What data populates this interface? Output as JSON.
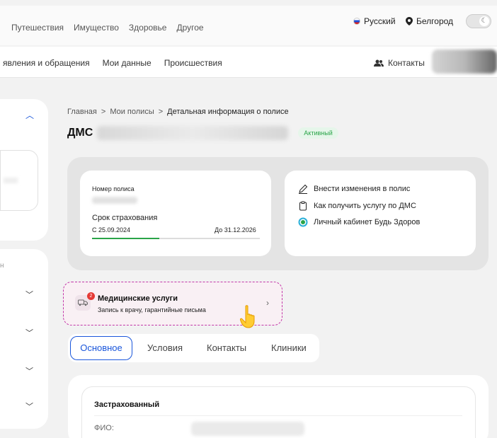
{
  "top_nav": {
    "links": [
      "Путешествия",
      "Имущество",
      "Здоровье",
      "Другое"
    ],
    "language": "Русский",
    "city": "Белгород"
  },
  "sub_nav": {
    "links": [
      "явления и обращения",
      "Мои данные",
      "Происшествия"
    ],
    "contacts": "Контакты"
  },
  "sidebar": {
    "section_label": "н"
  },
  "breadcrumb": {
    "home": "Главная",
    "policies": "Мои полисы",
    "current": "Детальная информация о полисе",
    "separator": ">"
  },
  "policy": {
    "title": "ДМС",
    "status": "Активный",
    "number_label": "Номер полиса",
    "term_label": "Срок страхования",
    "start": "С 25.09.2024",
    "end": "До 31.12.2026",
    "term_progress_fraction": 0.4
  },
  "actions": [
    {
      "label": "Внести изменения в полис",
      "icon": "pencil-icon"
    },
    {
      "label": "Как получить услугу по ДМС",
      "icon": "clipboard-icon"
    },
    {
      "label": "Личный кабинет Будь Здоров",
      "icon": "ring-logo-icon"
    }
  ],
  "medical": {
    "title": "Медицинские услуги",
    "subtitle": "Запись к врачу, гарантийные письма",
    "badge_count": "2"
  },
  "tabs": [
    "Основное",
    "Условия",
    "Контакты",
    "Клиники"
  ],
  "insured": {
    "title": "Застрахованный",
    "fio_label": "ФИО:"
  },
  "colors": {
    "accent_blue": "#1a56db",
    "green": "#2aa448",
    "dashed_magenta": "#c236a8"
  }
}
